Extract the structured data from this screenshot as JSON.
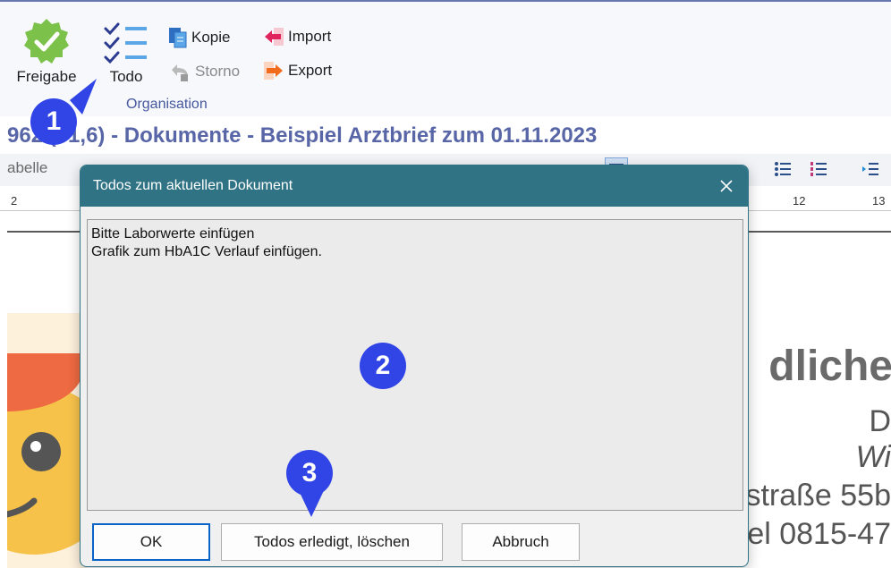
{
  "ribbon": {
    "freigabe_label": "Freigabe",
    "todo_label": "Todo",
    "kopie_label": "Kopie",
    "storno_label": "Storno",
    "import_label": "Import",
    "export_label": "Export",
    "group_label": "Organisation"
  },
  "document": {
    "title": "962 (61,6) - Dokumente - Beispiel Arztbrief zum 01.11.2023",
    "toolbar_text": "abelle",
    "ruler_left": "2",
    "ruler_12": "12",
    "ruler_13": "13",
    "big_text": "dliche",
    "line_d": "D",
    "line_wi": "Wi",
    "line_strasse": "straße 55b",
    "line_tel": "el 0815-47"
  },
  "dialog": {
    "title": "Todos zum aktuellen Dokument",
    "todos": [
      "Bitte Laborwerte einfügen",
      "Grafik zum HbA1C Verlauf einfügen."
    ],
    "ok_label": "OK",
    "done_label": "Todos erledigt, löschen",
    "cancel_label": "Abbruch"
  },
  "markers": [
    "1",
    "2",
    "3"
  ],
  "colors": {
    "accent": "#2f7385",
    "marker": "#3145e6",
    "title": "#5866a7"
  }
}
